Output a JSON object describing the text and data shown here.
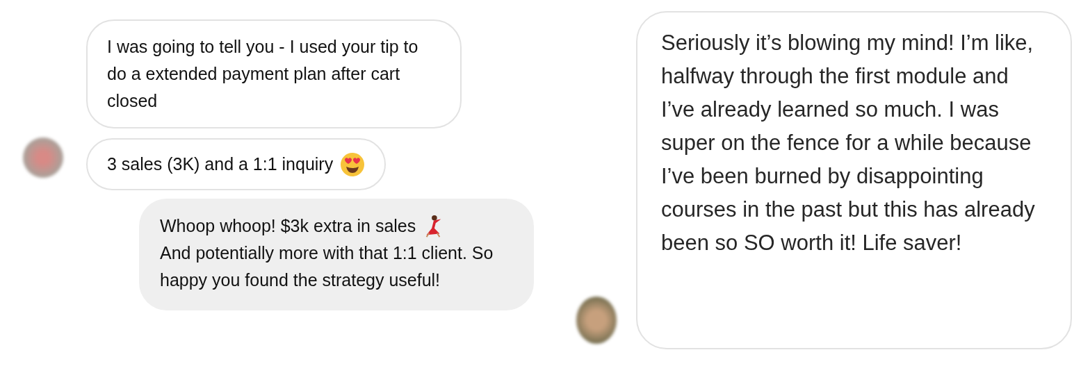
{
  "left_chat": {
    "received": [
      {
        "text": "I was going to tell you - I used your tip to do a extended payment plan after cart closed"
      },
      {
        "text": "3 sales (3K) and a 1:1 inquiry"
      }
    ],
    "sent": {
      "first_line": "Whoop whoop! $3k extra in sales",
      "rest": "And potentially more with that 1:1 client. So happy you found the strategy useful!"
    }
  },
  "right_chat": {
    "received": {
      "text": "Seriously it’s blowing my mind! I’m like, halfway through the first module and I’ve already learned so much. I was super on the fence for a while because I’ve been burned by disappointing courses in the past but this has already been so SO worth it! Life saver!"
    }
  }
}
